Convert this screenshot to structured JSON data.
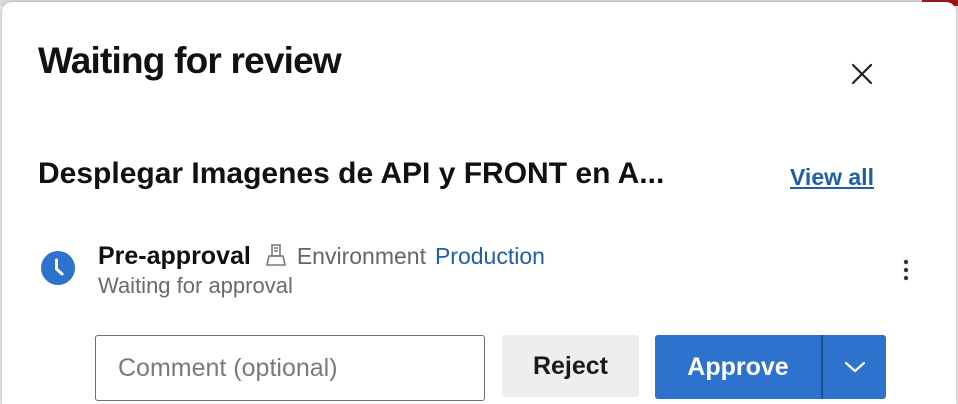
{
  "dialog": {
    "title": "Waiting for review",
    "close_icon": "close-icon"
  },
  "stage": {
    "name": "Desplegar Imagenes de API y FRONT en A...",
    "view_all_label": "View all"
  },
  "check": {
    "status_icon": "clock-icon",
    "name": "Pre-approval",
    "environment_icon": "environment-icon",
    "environment_label": "Environment",
    "environment_value": "Production",
    "status_text": "Waiting for approval",
    "more_icon": "more-options-icon"
  },
  "actions": {
    "comment_placeholder": "Comment (optional)",
    "comment_value": "",
    "reject_label": "Reject",
    "approve_label": "Approve",
    "approve_dropdown_icon": "chevron-down-icon"
  },
  "colors": {
    "accent": "#2d73cd",
    "link": "#1f5ea8",
    "status_icon": "#2d73cd",
    "reject_bg": "#eeeeee"
  }
}
